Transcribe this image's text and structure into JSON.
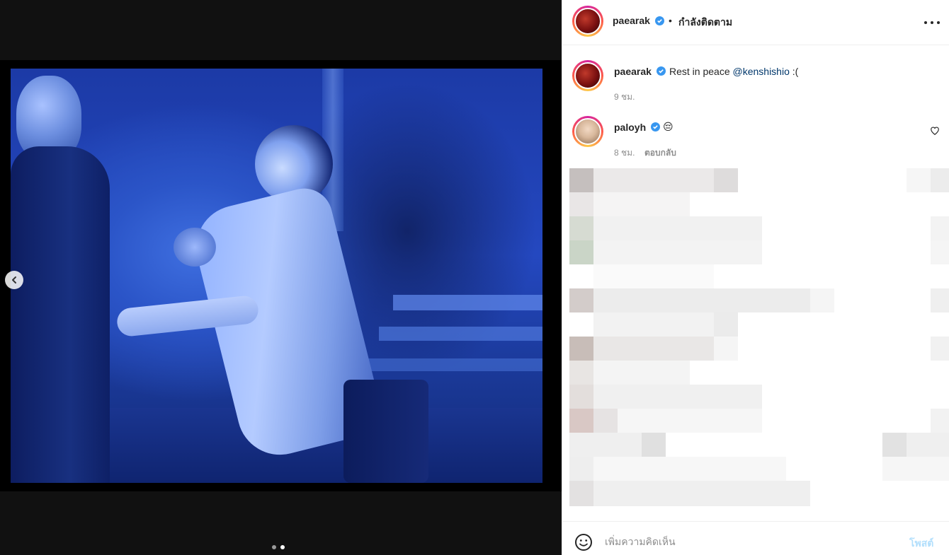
{
  "post": {
    "author": "paearak",
    "follow_state": "กำลังติดตาม",
    "separator": "•",
    "more_icon": "more-horizontal-icon"
  },
  "caption": {
    "username": "paearak",
    "text": "Rest in peace ",
    "mention": "@kenshishio",
    "text_after": " :(",
    "time": "9 ชม."
  },
  "comments": [
    {
      "username": "paloyh",
      "text": "😔",
      "time": "8 ชม.",
      "reply_label": "ตอบกลับ",
      "like_icon": "heart-outline-icon"
    }
  ],
  "media": {
    "carousel_index": 2,
    "carousel_total": 2,
    "prev_icon": "chevron-left-icon"
  },
  "comment_box": {
    "placeholder": "เพิ่มความคิดเห็น",
    "post_label": "โพสต์",
    "emoji_icon": "emoji-smile-icon"
  },
  "colors": {
    "verified": "#3897f0",
    "post_disabled": "#b2dffc",
    "link": "#00376b"
  }
}
